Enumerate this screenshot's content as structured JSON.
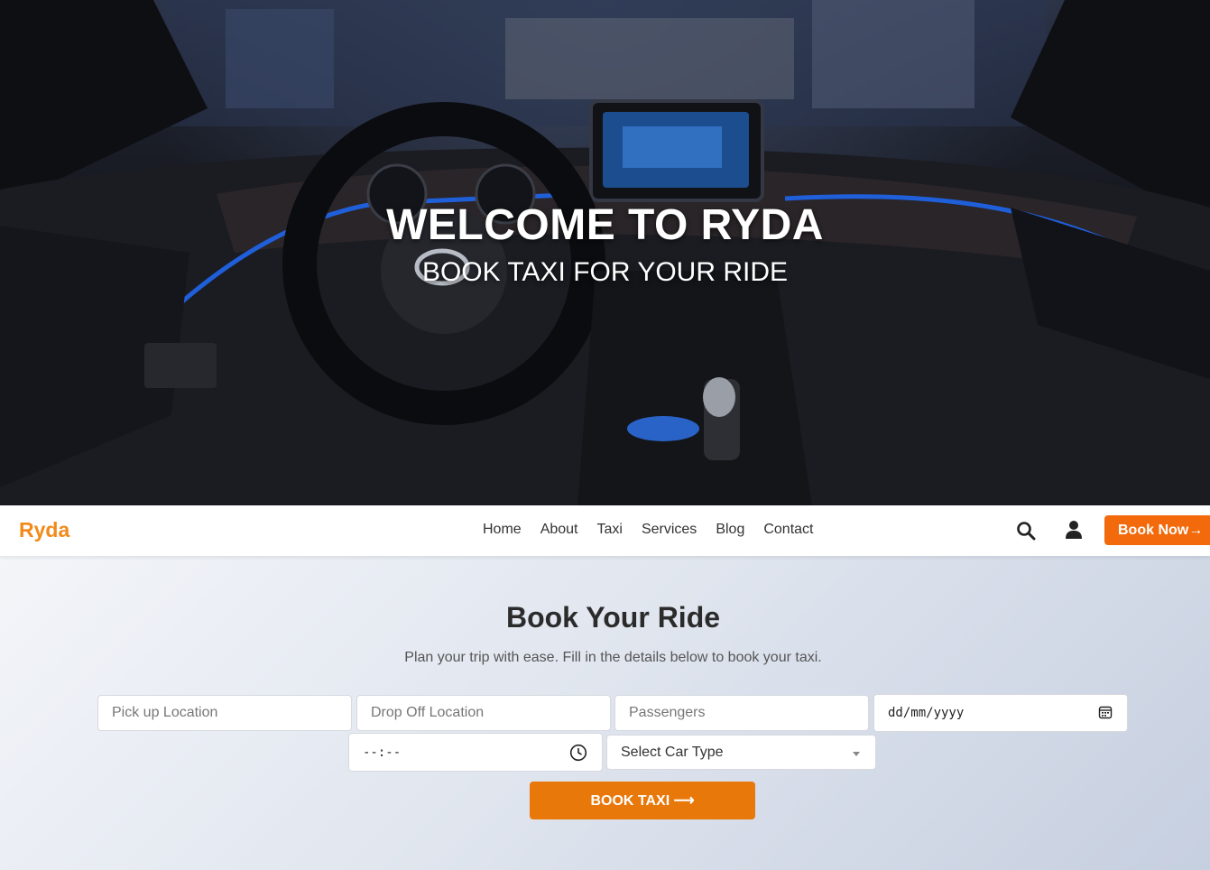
{
  "hero": {
    "title": "WELCOME TO RYDA",
    "subtitle": "BOOK TAXI FOR YOUR RIDE"
  },
  "navbar": {
    "logo": "Ryda",
    "links": [
      "Home",
      "About",
      "Taxi",
      "Services",
      "Blog",
      "Contact"
    ],
    "search_icon": "search-icon",
    "user_icon": "user-icon",
    "book_now": "Book Now→"
  },
  "booking": {
    "title": "Book Your Ride",
    "subtitle": "Plan your trip with ease. Fill in the details below to book your taxi.",
    "pickup_placeholder": "Pick up Location",
    "dropoff_placeholder": "Drop Off Location",
    "passengers_placeholder": "Passengers",
    "date_value": "dd/mm/yyyy",
    "time_value": "--:--",
    "car_type": "Select Car Type",
    "submit": "BOOK TAXI ⟶"
  },
  "colors": {
    "brand": "#f28a1a",
    "button": "#f26a0c",
    "submit": "#e8780a",
    "accent_light": "#1f5fd9"
  }
}
